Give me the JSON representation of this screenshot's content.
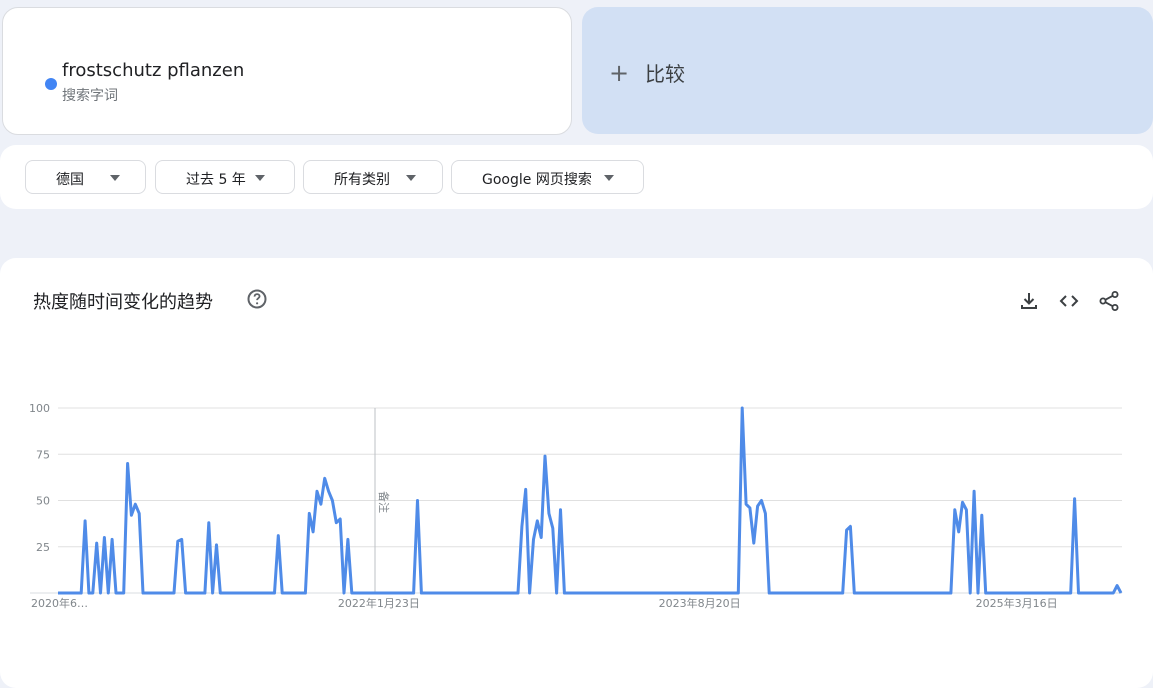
{
  "search_term": {
    "name": "frostschutz pflanzen",
    "type": "搜索字词",
    "color": "#4285f4"
  },
  "compare": {
    "plus": "+",
    "label": "比较"
  },
  "filters": {
    "region": "德国",
    "period": "过去 5 年",
    "category": "所有类别",
    "search_type": "Google 网页搜索"
  },
  "chart_section": {
    "title": "热度随时间变化的趋势",
    "help_icon": "help-circle-icon",
    "tools": [
      "download-icon",
      "embed-code-icon",
      "share-icon"
    ],
    "note_label": "备注"
  },
  "chart_data": {
    "type": "line",
    "title": "热度随时间变化的趋势",
    "xlabel": "",
    "ylabel": "",
    "ylim": [
      0,
      100
    ],
    "y_ticks": [
      100,
      75,
      50,
      25
    ],
    "x_tick_labels": [
      "2020年6…",
      "2022年1月23日",
      "2023年8月20日",
      "2025年3月16日"
    ],
    "x_tick_index": [
      0,
      83,
      166,
      248
    ],
    "grid": true,
    "line_color": "#4f8be8",
    "series": [
      {
        "values": [
          0,
          0,
          0,
          0,
          0,
          0,
          0,
          39,
          0,
          0,
          27,
          0,
          30,
          0,
          29,
          0,
          0,
          0,
          70,
          42,
          48,
          43,
          0,
          0,
          0,
          0,
          0,
          0,
          0,
          0,
          0,
          28,
          29,
          0,
          0,
          0,
          0,
          0,
          0,
          38,
          0,
          26,
          0,
          0,
          0,
          0,
          0,
          0,
          0,
          0,
          0,
          0,
          0,
          0,
          0,
          0,
          0,
          31,
          0,
          0,
          0,
          0,
          0,
          0,
          0,
          43,
          33,
          55,
          48,
          62,
          55,
          50,
          38,
          40,
          0,
          29,
          0,
          0,
          0,
          0,
          0,
          0,
          0,
          0,
          0,
          0,
          0,
          0,
          0,
          0,
          0,
          0,
          0,
          50,
          0,
          0,
          0,
          0,
          0,
          0,
          0,
          0,
          0,
          0,
          0,
          0,
          0,
          0,
          0,
          0,
          0,
          0,
          0,
          0,
          0,
          0,
          0,
          0,
          0,
          0,
          36,
          56,
          0,
          29,
          39,
          30,
          74,
          43,
          35,
          0,
          45,
          0,
          0,
          0,
          0,
          0,
          0,
          0,
          0,
          0,
          0,
          0,
          0,
          0,
          0,
          0,
          0,
          0,
          0,
          0,
          0,
          0,
          0,
          0,
          0,
          0,
          0,
          0,
          0,
          0,
          0,
          0,
          0,
          0,
          0,
          0,
          0,
          0,
          0,
          0,
          0,
          0,
          0,
          0,
          0,
          0,
          0,
          100,
          48,
          46,
          27,
          47,
          50,
          43,
          0,
          0,
          0,
          0,
          0,
          0,
          0,
          0,
          0,
          0,
          0,
          0,
          0,
          0,
          0,
          0,
          0,
          0,
          0,
          0,
          34,
          36,
          0,
          0,
          0,
          0,
          0,
          0,
          0,
          0,
          0,
          0,
          0,
          0,
          0,
          0,
          0,
          0,
          0,
          0,
          0,
          0,
          0,
          0,
          0,
          0,
          0,
          0,
          45,
          33,
          49,
          45,
          0,
          55,
          0,
          42,
          0,
          0,
          0,
          0,
          0,
          0,
          0,
          0,
          0,
          0,
          0,
          0,
          0,
          0,
          0,
          0,
          0,
          0,
          0,
          0,
          0,
          0,
          0,
          51,
          0,
          0,
          0,
          0,
          0,
          0,
          0,
          0,
          0,
          0,
          4,
          0
        ]
      }
    ]
  }
}
